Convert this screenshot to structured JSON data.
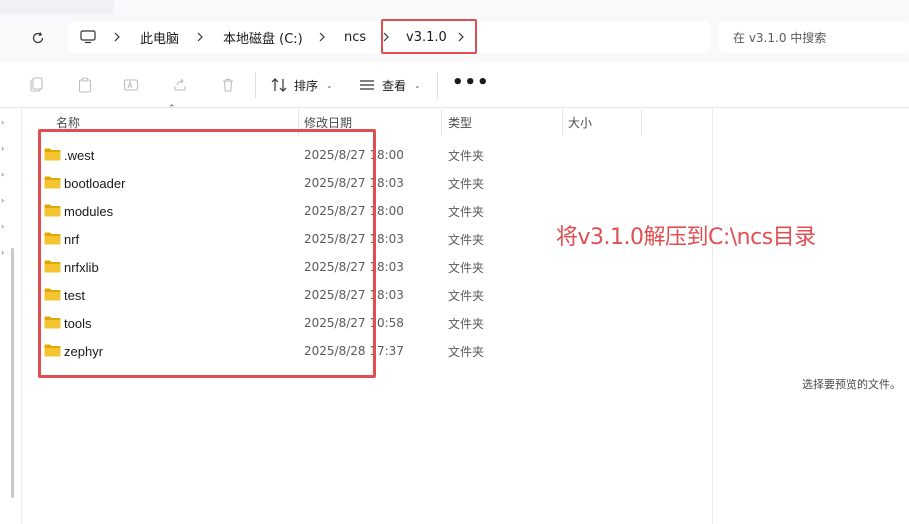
{
  "breadcrumb": {
    "items": [
      {
        "label": "此电脑"
      },
      {
        "label": "本地磁盘 (C:)"
      },
      {
        "label": "ncs"
      },
      {
        "label": "v3.1.0"
      }
    ]
  },
  "search": {
    "placeholder": "在 v3.1.0 中搜索"
  },
  "toolbar": {
    "sort_label": "排序",
    "view_label": "查看",
    "more_label": "•••"
  },
  "columns": {
    "name": "名称",
    "date": "修改日期",
    "type": "类型",
    "size": "大小"
  },
  "files": [
    {
      "name": ".west",
      "date": "2025/8/27 18:00",
      "type": "文件夹"
    },
    {
      "name": "bootloader",
      "date": "2025/8/27 18:03",
      "type": "文件夹"
    },
    {
      "name": "modules",
      "date": "2025/8/27 18:00",
      "type": "文件夹"
    },
    {
      "name": "nrf",
      "date": "2025/8/27 18:03",
      "type": "文件夹"
    },
    {
      "name": "nrfxlib",
      "date": "2025/8/27 18:03",
      "type": "文件夹"
    },
    {
      "name": "test",
      "date": "2025/8/27 18:03",
      "type": "文件夹"
    },
    {
      "name": "tools",
      "date": "2025/8/27 10:58",
      "type": "文件夹"
    },
    {
      "name": "zephyr",
      "date": "2025/8/28 17:37",
      "type": "文件夹"
    }
  ],
  "preview": {
    "empty_text": "选择要预览的文件。"
  },
  "annotation": {
    "text": "将v3.1.0解压到C:\\ncs目录"
  },
  "colors": {
    "highlight": "#e04e52",
    "folder": "#f4c430",
    "folder_dark": "#e0a800"
  }
}
